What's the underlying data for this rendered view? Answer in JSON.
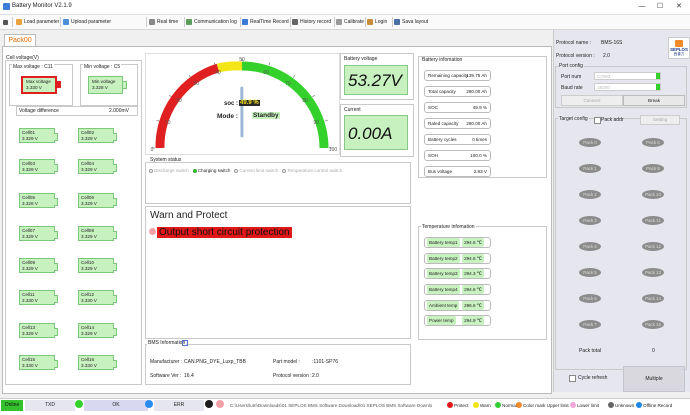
{
  "window": {
    "title": "Battery Monitor V2.1.9"
  },
  "toolbar": {
    "items": [
      "Load parameter",
      "Upload parameter",
      "Real time",
      "Communication log",
      "RealTime Record",
      "History record",
      "Calibrate",
      "Login",
      "Sava layout"
    ]
  },
  "tab": {
    "label": "Pack00"
  },
  "cell_voltage": {
    "title": "Cell voltage(V)",
    "max_label": "Max voltage : C11",
    "min_label": "Min voltage : C5",
    "max_box_title": "Max voltage",
    "max_box_value": "3.330 V",
    "min_box_title": "Min voltage",
    "min_box_value": "3.328 V",
    "diff_label": "Voltage difference",
    "diff_value": "2.000mV",
    "cells": [
      {
        "name": "Cell01",
        "value": "3.329 V"
      },
      {
        "name": "Cell02",
        "value": "3.329 V"
      },
      {
        "name": "Cell03",
        "value": "3.329 V"
      },
      {
        "name": "Cell04",
        "value": "3.329 V"
      },
      {
        "name": "Cell05",
        "value": "3.328 V"
      },
      {
        "name": "Cell06",
        "value": "3.329 V"
      },
      {
        "name": "Cell07",
        "value": "3.329 V"
      },
      {
        "name": "Cell08",
        "value": "3.329 V"
      },
      {
        "name": "Cell09",
        "value": "3.329 V"
      },
      {
        "name": "Cell10",
        "value": "3.329 V"
      },
      {
        "name": "Cell11",
        "value": "3.330 V"
      },
      {
        "name": "Cell12",
        "value": "3.330 V"
      },
      {
        "name": "Cell13",
        "value": "3.329 V"
      },
      {
        "name": "Cell14",
        "value": "3.329 V"
      },
      {
        "name": "Cell15",
        "value": "3.330 V"
      },
      {
        "name": "Cell16",
        "value": "3.330 V"
      }
    ]
  },
  "gauge": {
    "soc_label": "soc :",
    "soc_value": "49.9 %",
    "mode_label": "Mode :",
    "mode_value": "Standby",
    "ticks": [
      "0",
      "10",
      "20",
      "30",
      "40",
      "50",
      "60",
      "70",
      "80",
      "90",
      "100"
    ],
    "soc_fraction": 0.499,
    "colors": {
      "red": "#e02020",
      "yellow": "#f3e516",
      "green": "#34d12c"
    }
  },
  "battery_voltage": {
    "label": "Battery voltage",
    "value": "53.27V"
  },
  "current": {
    "label": "Current",
    "value": "0.00A"
  },
  "battery_info": {
    "title": "Battery infomation",
    "rows": [
      {
        "label": "Remaining capacity",
        "value": "139.75 Ah"
      },
      {
        "label": "Total capacity",
        "value": "280.00 Ah"
      },
      {
        "label": "SOC",
        "value": "49.9 %"
      },
      {
        "label": "Rated capacity",
        "value": "280.00 Ah"
      },
      {
        "label": "Battery cycles",
        "value": "0 times"
      },
      {
        "label": "SOH",
        "value": "100.0 %"
      },
      {
        "label": "Bus voltage",
        "value": "2.83 V"
      }
    ]
  },
  "system_status": {
    "title": "System status",
    "switches": [
      {
        "label": "Discharge switch",
        "checked": false
      },
      {
        "label": "Charging switch",
        "checked": true
      },
      {
        "label": "Current limit switch",
        "checked": false
      },
      {
        "label": "Temperature control switch",
        "checked": false
      }
    ]
  },
  "warn": {
    "title": "Warn and Protect",
    "message": "Output short circuit protection"
  },
  "temperature": {
    "title": "Temperature infomation",
    "rows": [
      {
        "label": "Battery temp1",
        "value": "294.6 ℃"
      },
      {
        "label": "Battery temp2",
        "value": "294.6 ℃"
      },
      {
        "label": "Battery temp3",
        "value": "294.3 ℃"
      },
      {
        "label": "Battery temp4",
        "value": "294.6 ℃"
      },
      {
        "label": "Ambient temp",
        "value": "296.6 ℃"
      },
      {
        "label": "Power temp",
        "value": "294.9 ℃"
      }
    ]
  },
  "bms_info": {
    "title": "BMS Information",
    "manufacturer_label": "Manufacturer :",
    "manufacturer_value": "CAN.PNG_DYE_Luxp_TBB",
    "model_label": "Part model :",
    "model_value": ":1101-SP76",
    "software_label": "Software Ver :",
    "software_value": "16.4",
    "protocol_label": "Protocol version :",
    "protocol_value": "2.0"
  },
  "right_panel": {
    "protocol_name_label": "Protocol name :",
    "protocol_name_value": "BMS-16S",
    "protocol_version_label": "Protocol version :",
    "protocol_version_value": "2.0",
    "logo_text": "SEPLOS",
    "logo_sub": "西普力",
    "port_config_title": "Port config",
    "port_num_label": "Port num",
    "port_num_value": "COM3",
    "baud_rate_label": "Baud rate",
    "baud_rate_value": "19200",
    "connect_label": "Connect",
    "break_label": "Break",
    "target_config_title": "Target config",
    "pack_addr_label": "Pack addr",
    "setting_label": "Setting",
    "packs": [
      "Pack 0",
      "Pack 8",
      "Pack 1",
      "Pack 9",
      "Pack 2",
      "Pack 10",
      "Pack 3",
      "Pack 11",
      "Pack 4",
      "Pack 12",
      "Pack 5",
      "Pack 13",
      "Pack 6",
      "Pack 14",
      "Pack 7",
      "Pack 15"
    ],
    "pack_total_label": "Pack total",
    "pack_total_value": "0",
    "cycle_refresh_label": "Cycle refresh",
    "multiple_label": "Multiple"
  },
  "statusbar": {
    "online": "Online",
    "txd": "TXD",
    "ok": "OK",
    "err": "ERR",
    "path": "C:\\Users\\lutri\\Downloads\\01 SEPLOS BMS Software Download\\01 SEPLOS BMS Software Downlo",
    "legend": [
      {
        "label": "Protect",
        "color": "#e01818"
      },
      {
        "label": "Warn",
        "color": "#f3e516"
      },
      {
        "label": "Normal",
        "color": "#33cc33"
      },
      {
        "label": "Color mark Upper limit",
        "color": "#f08a2a"
      },
      {
        "label": "Lower limit",
        "color": "#f0a8d8"
      },
      {
        "label": "Unknown",
        "color": "#666666"
      },
      {
        "label": "Offline Record",
        "color": "#1e88e5"
      }
    ]
  }
}
